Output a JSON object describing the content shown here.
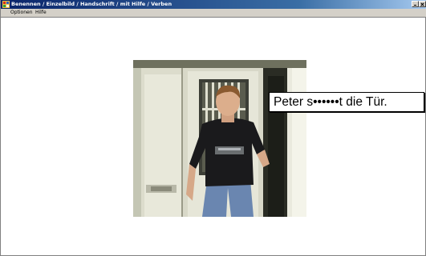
{
  "window": {
    "title": "Benennen / Einzelbild / Handschrift / mit Hilfe / Verben",
    "icon": "app-icon",
    "controls": [
      "minimize-icon",
      "close-icon"
    ],
    "title_gradient": [
      "#0a246a",
      "#a6caf0"
    ]
  },
  "menu": {
    "items": [
      {
        "label": "Optionen"
      },
      {
        "label": "Hilfe"
      }
    ]
  },
  "exercise": {
    "image": "photo of a young man in a black t-shirt and jeans standing in a doorway, holding the door",
    "caption": "Peter s••••••t die Tür."
  }
}
